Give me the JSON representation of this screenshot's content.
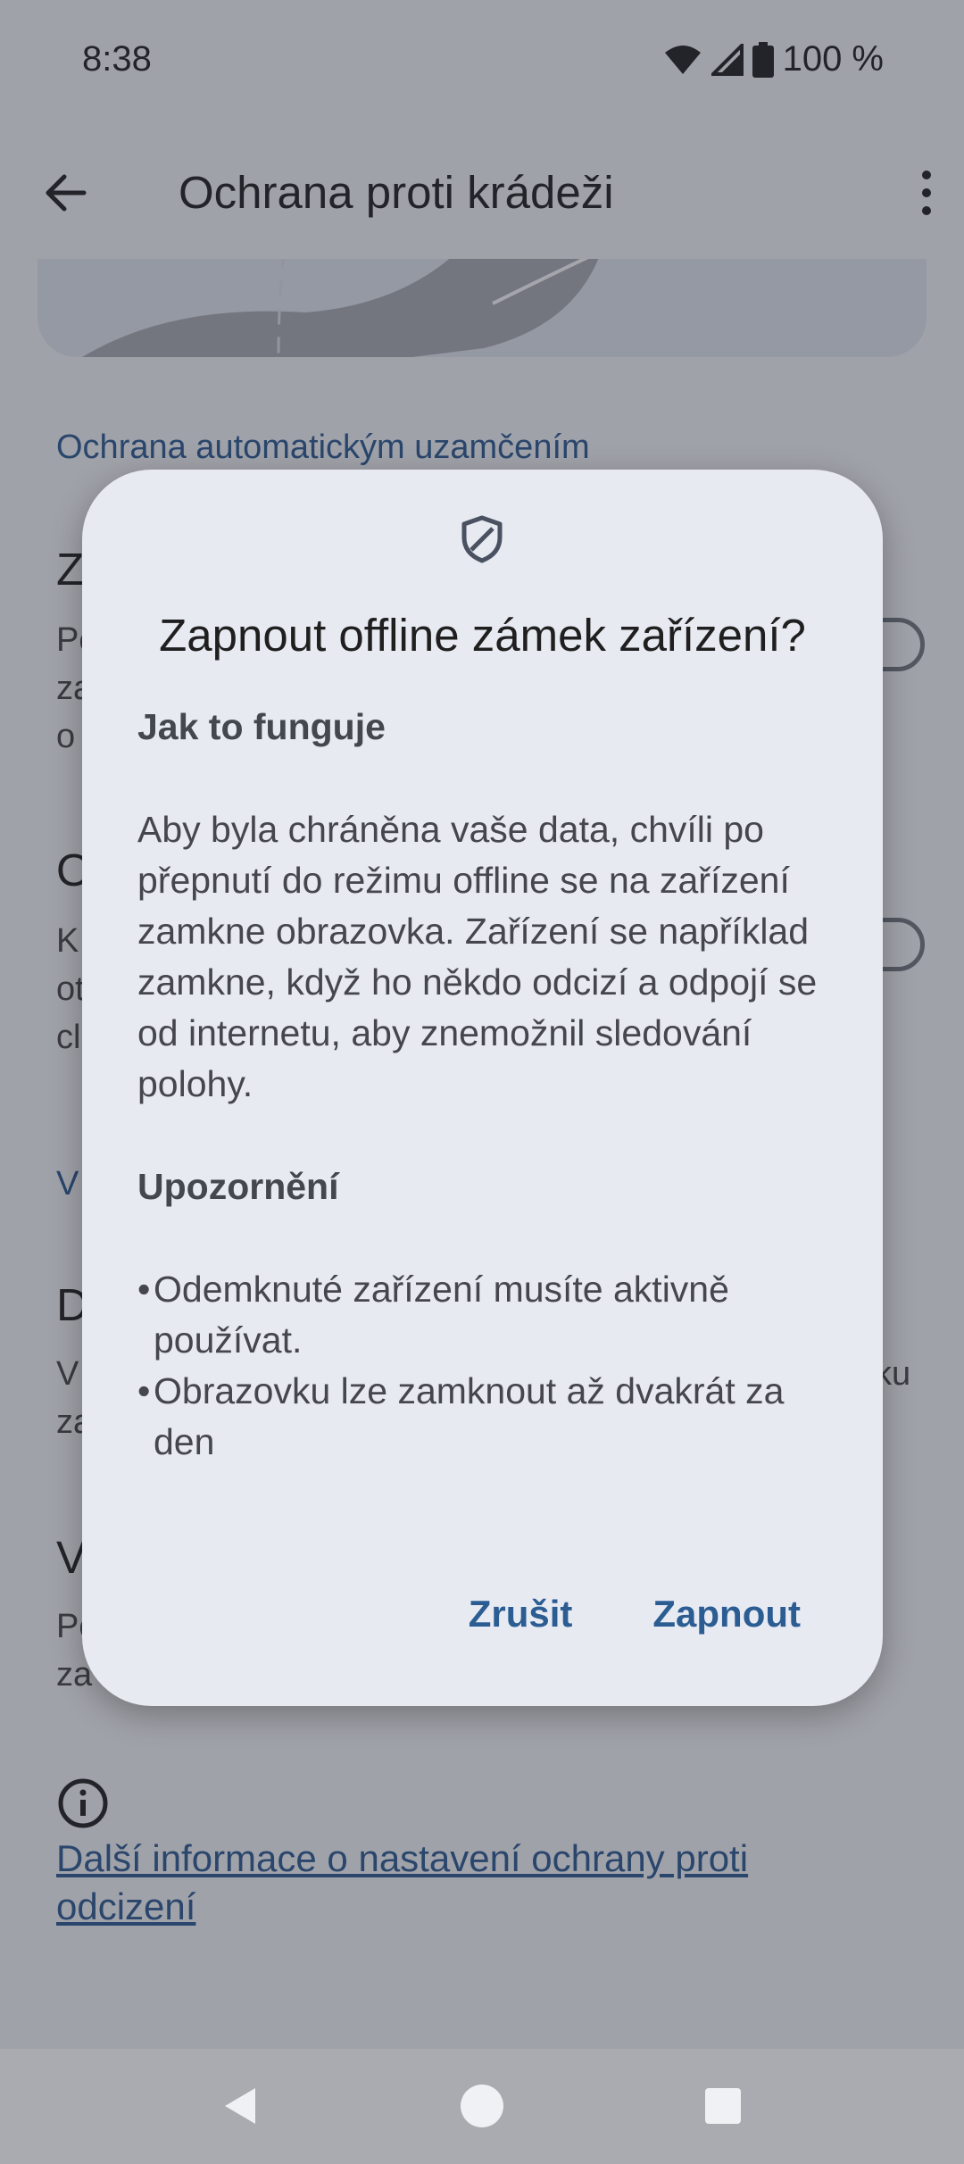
{
  "status_bar": {
    "time": "8:38",
    "battery_text": "100 %",
    "icons": [
      "wifi-icon",
      "signal-icon",
      "battery-icon"
    ]
  },
  "app_bar": {
    "title": "Ochrana proti krádeži",
    "icons": [
      "back-arrow-icon",
      "more-vert-icon"
    ]
  },
  "background": {
    "section_header": "Ochrana automatickým uzamčením",
    "items": [
      {
        "title": "Z",
        "subtitle_lines": [
          "Po",
          "za",
          "o"
        ]
      },
      {
        "title": "O",
        "subtitle_lines": [
          "K",
          "ot",
          "cl"
        ]
      }
    ],
    "section_header_2": "V",
    "items_2": [
      {
        "title": "D",
        "subtitle_lines": [
          "V",
          "za"
        ],
        "trailing": "ku"
      },
      {
        "title": "V",
        "subtitle_lines": [
          "Po",
          "za"
        ]
      }
    ],
    "learn_more": "Další informace o nastavení ochrany proti odcizení"
  },
  "dialog": {
    "icon": "shield-icon",
    "title": "Zapnout offline zámek zařízení?",
    "how_heading": "Jak to funguje",
    "how_text": "Aby byla chráněna vaše data, chvíli po přepnutí do režimu offline se na zařízení zamkne obrazovka. Zařízení se například zamkne, když ho někdo odcizí a odpojí se od internetu, aby znemožnil sledování polohy.",
    "warning_heading": "Upozornění",
    "bullets": [
      "Odemknuté zařízení musíte aktivně používat.",
      "Obrazovku lze zamknout až dvakrát za den"
    ],
    "cancel_label": "Zrušit",
    "confirm_label": "Zapnout"
  },
  "nav_bar": {
    "icons": [
      "back-triangle-icon",
      "home-circle-icon",
      "recents-square-icon"
    ]
  },
  "colors": {
    "accent": "#2c5a93",
    "dialog_bg": "#e8eaf2",
    "scrim": "#282c36"
  }
}
